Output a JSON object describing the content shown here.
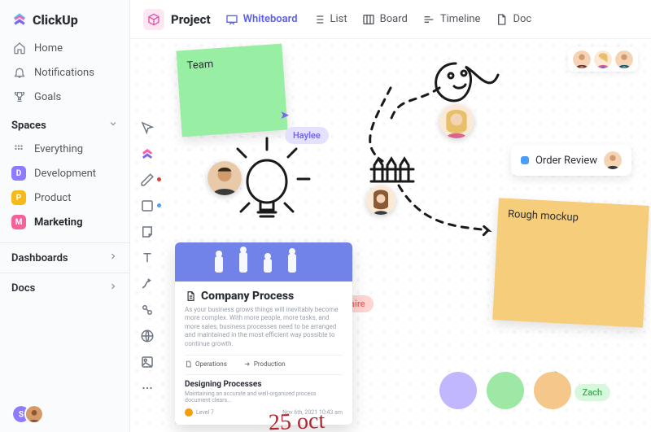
{
  "app": {
    "name": "ClickUp"
  },
  "nav": {
    "home": "Home",
    "notifications": "Notifications",
    "goals": "Goals"
  },
  "spaces": {
    "heading": "Spaces",
    "everything": "Everything",
    "items": [
      {
        "letter": "D",
        "label": "Development",
        "color": "#8e7bff"
      },
      {
        "letter": "P",
        "label": "Product",
        "color": "#f5b918"
      },
      {
        "letter": "M",
        "label": "Marketing",
        "color": "#f56199",
        "bold": true
      }
    ]
  },
  "sections": {
    "dashboards": "Dashboards",
    "docs": "Docs"
  },
  "topbar": {
    "project": "Project",
    "views": {
      "whiteboard": "Whiteboard",
      "list": "List",
      "board": "Board",
      "timeline": "Timeline",
      "doc": "Doc"
    }
  },
  "whiteboard": {
    "sticky_team": "Team",
    "sticky_rough": "Rough mockup",
    "cursors": {
      "haylee": "Haylee",
      "claire": "Claire",
      "zach": "Zach"
    },
    "task": {
      "title": "Order Review"
    },
    "doc_card": {
      "title": "Company Process",
      "desc": "As your business grows things will inevitably become more complex. With more people, more tasks, and more sales, business processes need to be arranged and maintained in the most efficient way possible to continue growth.",
      "op1": "Operations",
      "op2": "Production",
      "sub": "Designing Processes",
      "sub_desc": "Maintaining an accurate and well-organized process document clears...",
      "level": "Level 7",
      "date": "Nov 6th, 2021 10:43 am"
    },
    "hand_date": "25 oct",
    "circle_colors": [
      "#c0b7ff",
      "#9de8a5",
      "#f5c78b"
    ]
  },
  "presence_dots": [
    "#e86a64",
    "#7366f5",
    "#46b15a"
  ]
}
